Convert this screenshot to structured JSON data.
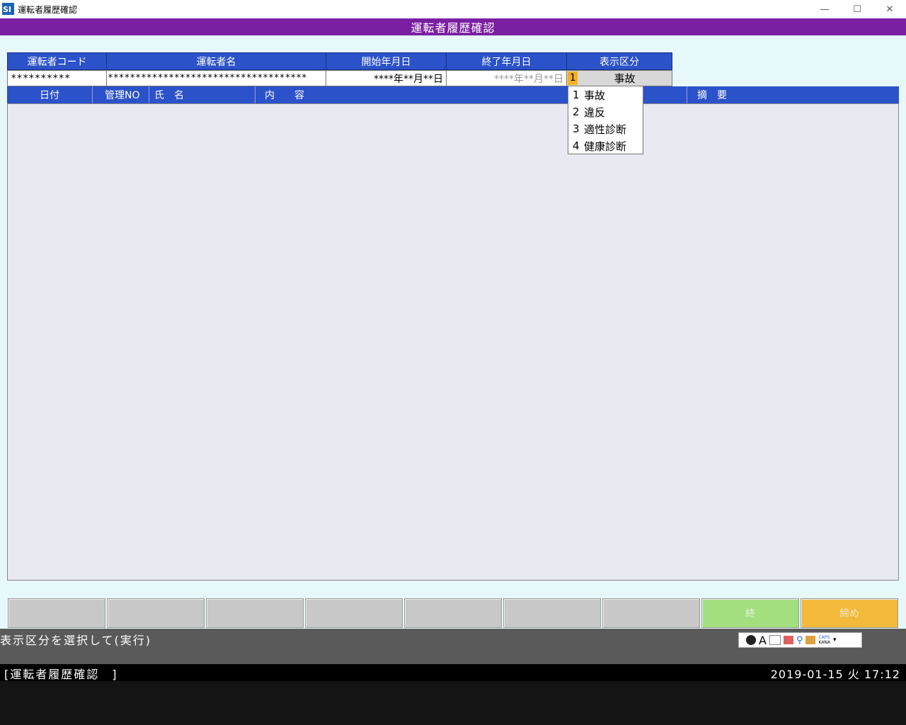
{
  "window": {
    "title": "運転者履歴確認",
    "minimize_icon": "minimize-icon",
    "maximize_icon": "maximize-icon",
    "close_icon": "close-icon"
  },
  "header": {
    "title": "運転者履歴確認"
  },
  "form": {
    "driver_code": {
      "label": "運転者コード",
      "value": "**********"
    },
    "driver_name": {
      "label": "運転者名",
      "value": "************************************"
    },
    "start_date": {
      "label": "開始年月日",
      "value": "****年**月**日"
    },
    "end_date": {
      "label": "終了年月日",
      "value": "****年**月**日"
    },
    "display_type": {
      "label": "表示区分",
      "code": "1",
      "value": "事故"
    }
  },
  "grid": {
    "columns": [
      "日付",
      "管理NO",
      "氏　名",
      "内　　容",
      "摘　要"
    ]
  },
  "dropdown": {
    "options": [
      {
        "num": "1",
        "label": "事故"
      },
      {
        "num": "2",
        "label": "違反"
      },
      {
        "num": "3",
        "label": "適性診断"
      },
      {
        "num": "4",
        "label": "健康診断"
      }
    ]
  },
  "function_keys": [
    {
      "label": ""
    },
    {
      "label": ""
    },
    {
      "label": ""
    },
    {
      "label": ""
    },
    {
      "label": ""
    },
    {
      "label": ""
    },
    {
      "label": ""
    },
    {
      "label": "終",
      "color": "#a3df7f"
    },
    {
      "label": "締め",
      "color": "#f2b93b"
    }
  ],
  "status": {
    "message": "表示区分を選択して(実行)",
    "ime": {
      "mode": "A",
      "caps": "CAPS",
      "kana": "KANA"
    }
  },
  "bottom": {
    "title": "[運転者履歴確認　]",
    "datetime": "2019-01-15 火 17:12"
  },
  "colors": {
    "header": "#7b1fa2",
    "column_header": "#2b52c9",
    "selected_code": "#f3b320"
  }
}
